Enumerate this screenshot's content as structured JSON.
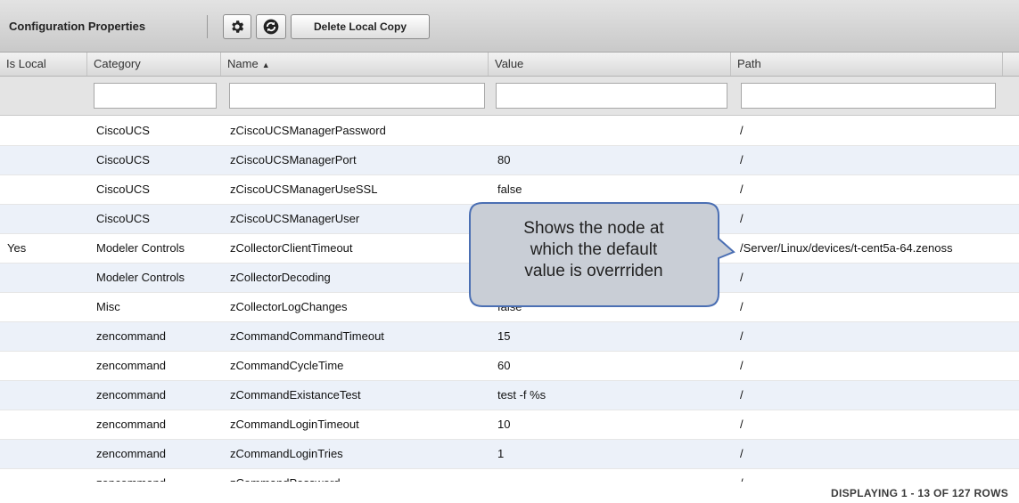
{
  "toolbar": {
    "title": "Configuration Properties",
    "settings_icon": "gear-icon",
    "refresh_icon": "refresh-icon",
    "delete_label": "Delete Local Copy"
  },
  "columns": {
    "is_local": "Is Local",
    "category": "Category",
    "name": "Name",
    "value": "Value",
    "path": "Path"
  },
  "filters": {
    "category": "",
    "name": "",
    "value": "",
    "path": ""
  },
  "rows": [
    {
      "is_local": "",
      "category": "CiscoUCS",
      "name": "zCiscoUCSManagerPassword",
      "value": "",
      "path": "/"
    },
    {
      "is_local": "",
      "category": "CiscoUCS",
      "name": "zCiscoUCSManagerPort",
      "value": "80",
      "path": "/"
    },
    {
      "is_local": "",
      "category": "CiscoUCS",
      "name": "zCiscoUCSManagerUseSSL",
      "value": "false",
      "path": "/"
    },
    {
      "is_local": "",
      "category": "CiscoUCS",
      "name": "zCiscoUCSManagerUser",
      "value": "",
      "path": "/"
    },
    {
      "is_local": "Yes",
      "category": "Modeler Controls",
      "name": "zCollectorClientTimeout",
      "value": "",
      "path": "/Server/Linux/devices/t-cent5a-64.zenoss"
    },
    {
      "is_local": "",
      "category": "Modeler Controls",
      "name": "zCollectorDecoding",
      "value": "",
      "path": "/"
    },
    {
      "is_local": "",
      "category": "Misc",
      "name": "zCollectorLogChanges",
      "value": "false",
      "path": "/"
    },
    {
      "is_local": "",
      "category": "zencommand",
      "name": "zCommandCommandTimeout",
      "value": "15",
      "path": "/"
    },
    {
      "is_local": "",
      "category": "zencommand",
      "name": "zCommandCycleTime",
      "value": "60",
      "path": "/"
    },
    {
      "is_local": "",
      "category": "zencommand",
      "name": "zCommandExistanceTest",
      "value": "test -f %s",
      "path": "/"
    },
    {
      "is_local": "",
      "category": "zencommand",
      "name": "zCommandLoginTimeout",
      "value": "10",
      "path": "/"
    },
    {
      "is_local": "",
      "category": "zencommand",
      "name": "zCommandLoginTries",
      "value": "1",
      "path": "/"
    },
    {
      "is_local": "",
      "category": "zencommand",
      "name": "zCommandPassword",
      "value": "",
      "path": "/"
    }
  ],
  "footer": {
    "status": "DISPLAYING 1 - 13 OF 127 ROWS"
  },
  "callout": {
    "line1": "Shows the node at",
    "line2": "which the default",
    "line3": "value is overrriden"
  },
  "colors": {
    "row_alt": "#ecf1f9",
    "callout_fill": "#c9ced6",
    "callout_border": "#4b6fb3"
  }
}
